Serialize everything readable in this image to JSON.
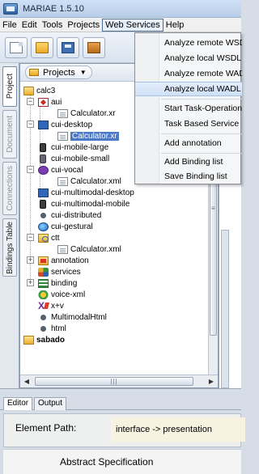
{
  "window": {
    "title": "MARIAE 1.5.10"
  },
  "menubar": {
    "items": [
      "File",
      "Edit",
      "Tools",
      "Projects",
      "Web Services",
      "Help"
    ],
    "active_index": 4
  },
  "toolbar": {
    "buttons": [
      {
        "icon": "new-document-icon"
      },
      {
        "icon": "open-folder-icon"
      },
      {
        "icon": "save-icon"
      },
      {
        "icon": "tool-icon"
      }
    ]
  },
  "side_tabs": {
    "tabs": [
      "Project",
      "Document",
      "Connections",
      "Bindings Table"
    ],
    "selected_index": 0
  },
  "projects_panel": {
    "dropdown_label": "Projects"
  },
  "tree": {
    "nodes": [
      {
        "label": "calc3",
        "icon": "project-folder-icon",
        "bold": false
      },
      {
        "label": "aui",
        "icon": "aui-model-icon"
      },
      {
        "label": "Calculator.xr",
        "icon": "file-icon"
      },
      {
        "label": "cui-desktop",
        "icon": "desktop-icon"
      },
      {
        "label": "Calculator.xr",
        "icon": "file-icon",
        "selected": true
      },
      {
        "label": "cui-mobile-large",
        "icon": "mobile-icon"
      },
      {
        "label": "cui-mobile-small",
        "icon": "mobile-icon"
      },
      {
        "label": "cui-vocal",
        "icon": "vocal-icon"
      },
      {
        "label": "Calculator.xml",
        "icon": "file-icon"
      },
      {
        "label": "cui-multimodal-desktop",
        "icon": "desktop-icon"
      },
      {
        "label": "cui-multimodal-mobile",
        "icon": "mobile-icon"
      },
      {
        "label": "cui-distributed",
        "icon": "distributed-icon"
      },
      {
        "label": "cui-gestural",
        "icon": "globe-icon"
      },
      {
        "label": "ctt",
        "icon": "ctt-folder-icon"
      },
      {
        "label": "Calculator.xml",
        "icon": "file-icon"
      },
      {
        "label": "annotation",
        "icon": "annotation-folder-icon"
      },
      {
        "label": "services",
        "icon": "services-icon"
      },
      {
        "label": "binding",
        "icon": "binding-icon"
      },
      {
        "label": "voice-xml",
        "icon": "voicexml-icon"
      },
      {
        "label": "x+v",
        "icon": "xv-icon"
      },
      {
        "label": "MultimodalHtml",
        "icon": "bullet-icon"
      },
      {
        "label": "html",
        "icon": "bullet-icon"
      },
      {
        "label": "sabado",
        "icon": "project-folder-icon",
        "bold": true
      }
    ]
  },
  "web_services_menu": {
    "items": [
      {
        "label": "Analyze remote WSDL"
      },
      {
        "label": "Analyze local WSDL"
      },
      {
        "label": "Analyze remote WADL"
      },
      {
        "label": "Analyze local WADL",
        "hover": true
      },
      {
        "label": "Start Task-Operation Binding"
      },
      {
        "label": "Task Based Service Filter"
      },
      {
        "label": "Add annotation"
      },
      {
        "label": "Add Binding list"
      },
      {
        "label": "Save Binding list"
      }
    ]
  },
  "bottom_panel": {
    "tabs": [
      "Editor",
      "Output"
    ],
    "selected_tab": 0,
    "element_path_label": "Element Path:",
    "element_path_value": "interface -> presentation",
    "abstract_label": "Abstract Specification"
  },
  "colors": {
    "selection": "#4b79c6",
    "menu_hover": "#cfe0f6",
    "panel_bg": "#d6dde6"
  }
}
